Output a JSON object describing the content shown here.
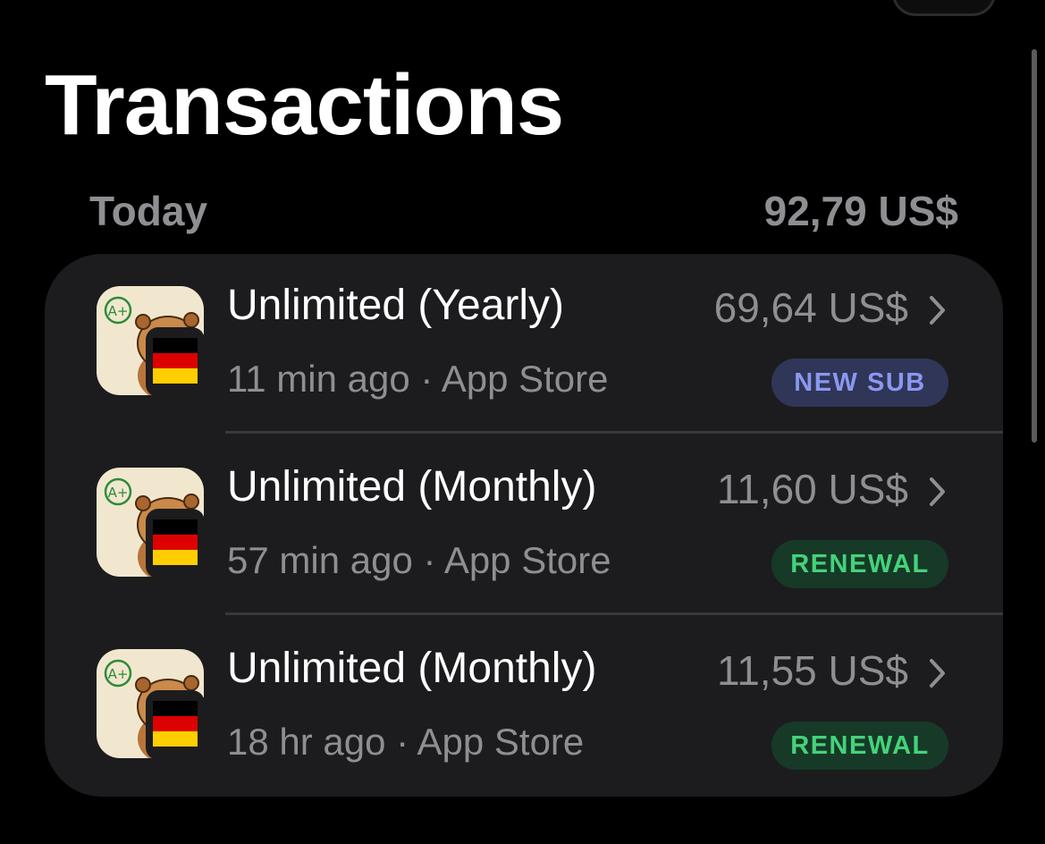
{
  "screen": {
    "title": "Transactions"
  },
  "section": {
    "label": "Today",
    "total": "92,79 US$"
  },
  "transactions": [
    {
      "product": "Unlimited (Yearly)",
      "time": "11 min ago",
      "store": "App Store",
      "subtitle": "11 min ago · App Store",
      "amount": "69,64 US$",
      "badge": "NEW SUB",
      "badge_type": "new-sub"
    },
    {
      "product": "Unlimited (Monthly)",
      "time": "57 min ago",
      "store": "App Store",
      "subtitle": "57 min ago · App Store",
      "amount": "11,60 US$",
      "badge": "RENEWAL",
      "badge_type": "renewal"
    },
    {
      "product": "Unlimited (Monthly)",
      "time": "18 hr ago",
      "store": "App Store",
      "subtitle": "18 hr ago · App Store",
      "amount": "11,55 US$",
      "badge": "RENEWAL",
      "badge_type": "renewal"
    }
  ],
  "app_icon": {
    "name": "beaver-app-icon",
    "grade_mark": "A+",
    "flag": "germany-flag-icon"
  },
  "colors": {
    "background": "#000000",
    "card": "#1c1c1e",
    "secondary_text": "#8e8e93",
    "new_sub_bg": "#2f3658",
    "new_sub_text": "#8b97f0",
    "renewal_bg": "#163a27",
    "renewal_text": "#45d27a"
  }
}
